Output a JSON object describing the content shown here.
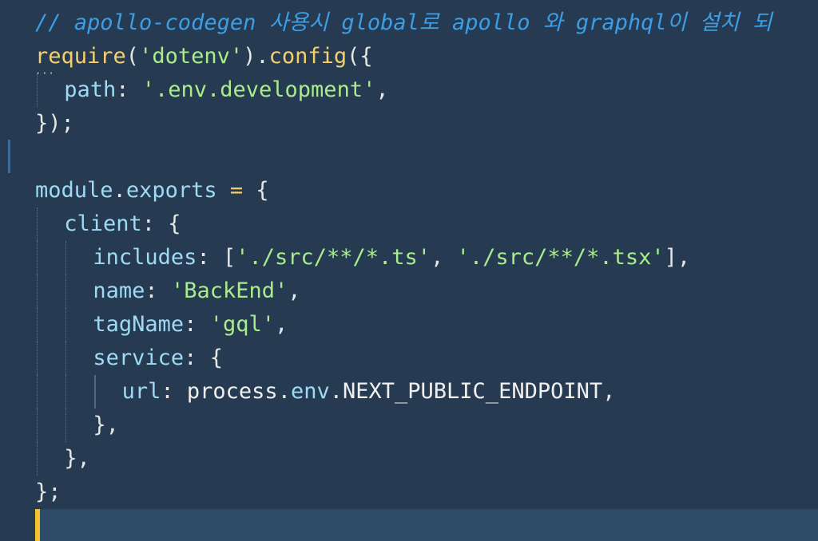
{
  "editor": {
    "language": "javascript",
    "colors": {
      "background": "#263b51",
      "current_line": "#2d4a66",
      "cursor": "#f2c230",
      "comment": "#3c9ee7",
      "string": "#a9ec8e",
      "property": "#9fdaf5",
      "function": "#f5cf6e"
    },
    "lines": [
      {
        "indent": 0,
        "tokens": [
          {
            "t": "// apollo-codegen 사용시 global로 apollo 와 graphql이 설치 되",
            "c": "comment"
          }
        ]
      },
      {
        "indent": 0,
        "tokens": [
          {
            "t": "require",
            "c": "fn"
          },
          {
            "t": "(",
            "c": "punc"
          },
          {
            "t": "'dotenv'",
            "c": "str"
          },
          {
            "t": ").",
            "c": "punc"
          },
          {
            "t": "config",
            "c": "fn"
          },
          {
            "t": "({",
            "c": "punc"
          }
        ]
      },
      {
        "indent": 1,
        "tokens": [
          {
            "t": "path",
            "c": "key"
          },
          {
            "t": ": ",
            "c": "punc"
          },
          {
            "t": "'.env.development'",
            "c": "str"
          },
          {
            "t": ",",
            "c": "punc"
          }
        ]
      },
      {
        "indent": 0,
        "tokens": [
          {
            "t": "});",
            "c": "punc"
          }
        ]
      },
      {
        "indent": 0,
        "tokens": []
      },
      {
        "indent": 0,
        "tokens": [
          {
            "t": "module",
            "c": "key"
          },
          {
            "t": ".",
            "c": "punc"
          },
          {
            "t": "exports",
            "c": "key"
          },
          {
            "t": " ",
            "c": "punc"
          },
          {
            "t": "=",
            "c": "op"
          },
          {
            "t": " {",
            "c": "punc"
          }
        ]
      },
      {
        "indent": 1,
        "tokens": [
          {
            "t": "client",
            "c": "key"
          },
          {
            "t": ": {",
            "c": "punc"
          }
        ]
      },
      {
        "indent": 2,
        "tokens": [
          {
            "t": "includes",
            "c": "key"
          },
          {
            "t": ": [",
            "c": "punc"
          },
          {
            "t": "'./src/**/*.ts'",
            "c": "str"
          },
          {
            "t": ", ",
            "c": "punc"
          },
          {
            "t": "'./src/**/*.tsx'",
            "c": "str"
          },
          {
            "t": "],",
            "c": "punc"
          }
        ]
      },
      {
        "indent": 2,
        "tokens": [
          {
            "t": "name",
            "c": "key"
          },
          {
            "t": ": ",
            "c": "punc"
          },
          {
            "t": "'BackEnd'",
            "c": "str"
          },
          {
            "t": ",",
            "c": "punc"
          }
        ]
      },
      {
        "indent": 2,
        "tokens": [
          {
            "t": "tagName",
            "c": "key"
          },
          {
            "t": ": ",
            "c": "punc"
          },
          {
            "t": "'gql'",
            "c": "str"
          },
          {
            "t": ",",
            "c": "punc"
          }
        ]
      },
      {
        "indent": 2,
        "tokens": [
          {
            "t": "service",
            "c": "key"
          },
          {
            "t": ": {",
            "c": "punc"
          }
        ]
      },
      {
        "indent": 3,
        "tokens": [
          {
            "t": "url",
            "c": "key"
          },
          {
            "t": ": ",
            "c": "punc"
          },
          {
            "t": "process",
            "c": "plain"
          },
          {
            "t": ".",
            "c": "punc"
          },
          {
            "t": "env",
            "c": "key"
          },
          {
            "t": ".",
            "c": "punc"
          },
          {
            "t": "NEXT_PUBLIC_ENDPOINT",
            "c": "plain"
          },
          {
            "t": ",",
            "c": "punc"
          }
        ]
      },
      {
        "indent": 2,
        "tokens": [
          {
            "t": "},",
            "c": "punc"
          }
        ]
      },
      {
        "indent": 1,
        "tokens": [
          {
            "t": "},",
            "c": "punc"
          }
        ]
      },
      {
        "indent": 0,
        "tokens": [
          {
            "t": "};",
            "c": "punc"
          }
        ]
      },
      {
        "indent": 0,
        "tokens": [],
        "current": true
      }
    ]
  }
}
